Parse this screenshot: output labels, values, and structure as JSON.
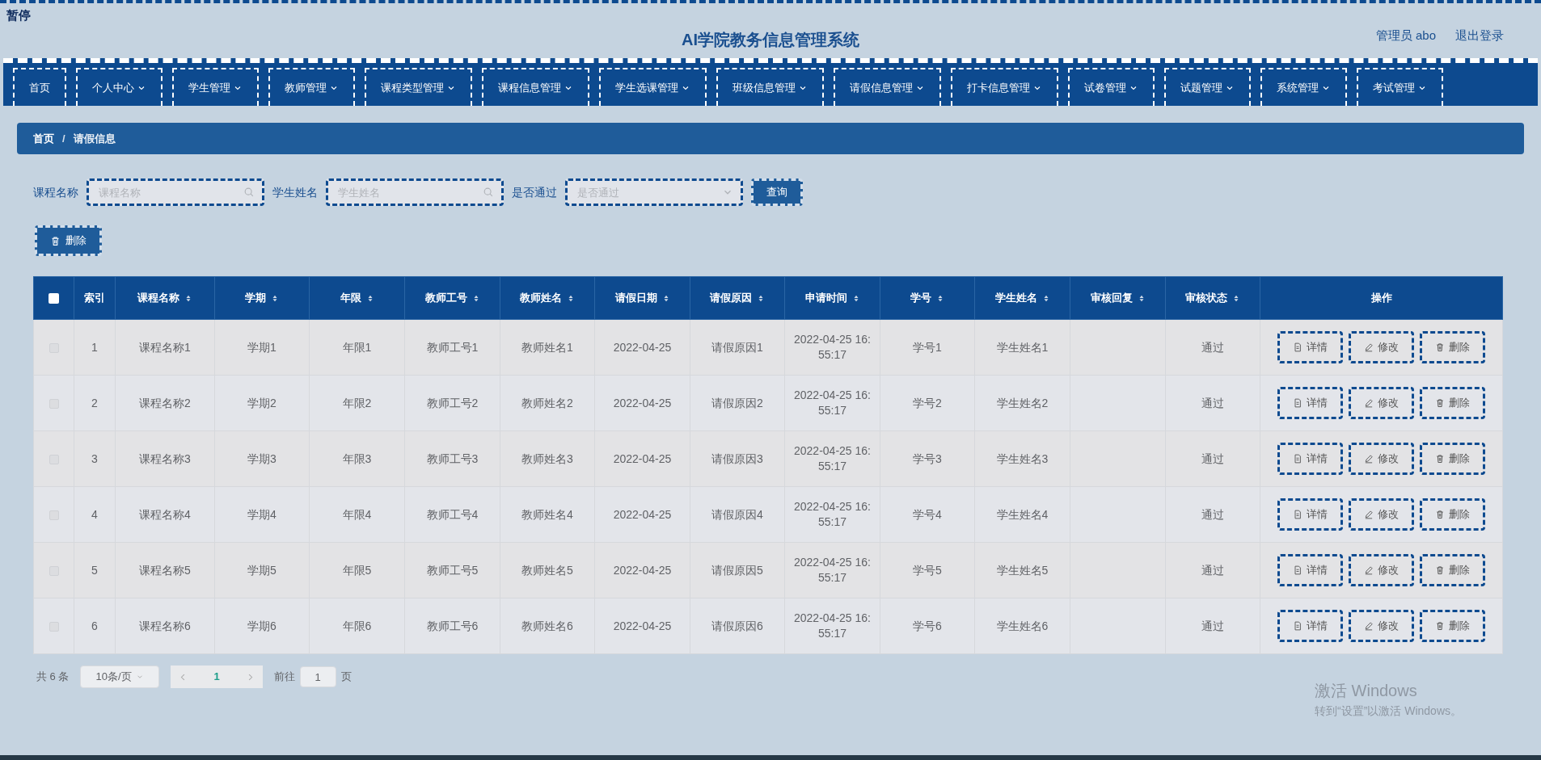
{
  "pause_label": "暂停",
  "header": {
    "title": "AI学院教务信息管理系统",
    "user": "管理员 abo",
    "logout": "退出登录"
  },
  "nav": [
    {
      "label": "首页",
      "dropdown": false
    },
    {
      "label": "个人中心",
      "dropdown": true
    },
    {
      "label": "学生管理",
      "dropdown": true
    },
    {
      "label": "教师管理",
      "dropdown": true
    },
    {
      "label": "课程类型管理",
      "dropdown": true
    },
    {
      "label": "课程信息管理",
      "dropdown": true
    },
    {
      "label": "学生选课管理",
      "dropdown": true
    },
    {
      "label": "班级信息管理",
      "dropdown": true
    },
    {
      "label": "请假信息管理",
      "dropdown": true
    },
    {
      "label": "打卡信息管理",
      "dropdown": true
    },
    {
      "label": "试卷管理",
      "dropdown": true
    },
    {
      "label": "试题管理",
      "dropdown": true
    },
    {
      "label": "系统管理",
      "dropdown": true
    },
    {
      "label": "考试管理",
      "dropdown": true
    }
  ],
  "breadcrumb": {
    "items": [
      "首页",
      "请假信息"
    ],
    "separator": "/"
  },
  "filters": [
    {
      "label": "课程名称",
      "placeholder": "课程名称",
      "kind": "search"
    },
    {
      "label": "学生姓名",
      "placeholder": "学生姓名",
      "kind": "search"
    },
    {
      "label": "是否通过",
      "placeholder": "是否通过",
      "kind": "select"
    }
  ],
  "search_button": "查询",
  "delete_button": "删除",
  "table": {
    "select_all_checked": false,
    "columns": [
      {
        "label": "索引",
        "sortable": false
      },
      {
        "label": "课程名称",
        "sortable": true
      },
      {
        "label": "学期",
        "sortable": true
      },
      {
        "label": "年限",
        "sortable": true
      },
      {
        "label": "教师工号",
        "sortable": true
      },
      {
        "label": "教师姓名",
        "sortable": true
      },
      {
        "label": "请假日期",
        "sortable": true
      },
      {
        "label": "请假原因",
        "sortable": true
      },
      {
        "label": "申请时间",
        "sortable": true
      },
      {
        "label": "学号",
        "sortable": true
      },
      {
        "label": "学生姓名",
        "sortable": true
      },
      {
        "label": "审核回复",
        "sortable": true
      },
      {
        "label": "审核状态",
        "sortable": true
      },
      {
        "label": "操作",
        "sortable": false
      }
    ],
    "rows": [
      {
        "checked": false,
        "cells": [
          "1",
          "课程名称1",
          "学期1",
          "年限1",
          "教师工号1",
          "教师姓名1",
          "2022-04-25",
          "请假原因1",
          "2022-04-25 16:55:17",
          "学号1",
          "学生姓名1",
          null,
          "通过"
        ],
        "actions": [
          "详情",
          "修改",
          "删除"
        ]
      },
      {
        "checked": false,
        "cells": [
          "2",
          "课程名称2",
          "学期2",
          "年限2",
          "教师工号2",
          "教师姓名2",
          "2022-04-25",
          "请假原因2",
          "2022-04-25 16:55:17",
          "学号2",
          "学生姓名2",
          null,
          "通过"
        ],
        "actions": [
          "详情",
          "修改",
          "删除"
        ]
      },
      {
        "checked": false,
        "cells": [
          "3",
          "课程名称3",
          "学期3",
          "年限3",
          "教师工号3",
          "教师姓名3",
          "2022-04-25",
          "请假原因3",
          "2022-04-25 16:55:17",
          "学号3",
          "学生姓名3",
          null,
          "通过"
        ],
        "actions": [
          "详情",
          "修改",
          "删除"
        ]
      },
      {
        "checked": false,
        "cells": [
          "4",
          "课程名称4",
          "学期4",
          "年限4",
          "教师工号4",
          "教师姓名4",
          "2022-04-25",
          "请假原因4",
          "2022-04-25 16:55:17",
          "学号4",
          "学生姓名4",
          null,
          "通过"
        ],
        "actions": [
          "详情",
          "修改",
          "删除"
        ]
      },
      {
        "checked": false,
        "cells": [
          "5",
          "课程名称5",
          "学期5",
          "年限5",
          "教师工号5",
          "教师姓名5",
          "2022-04-25",
          "请假原因5",
          "2022-04-25 16:55:17",
          "学号5",
          "学生姓名5",
          null,
          "通过"
        ],
        "actions": [
          "详情",
          "修改",
          "删除"
        ]
      },
      {
        "checked": false,
        "cells": [
          "6",
          "课程名称6",
          "学期6",
          "年限6",
          "教师工号6",
          "教师姓名6",
          "2022-04-25",
          "请假原因6",
          "2022-04-25 16:55:17",
          "学号6",
          "学生姓名6",
          null,
          "通过"
        ],
        "actions": [
          "详情",
          "修改",
          "删除"
        ]
      }
    ]
  },
  "pagination": {
    "total": "共 6 条",
    "page_size": "10条/页",
    "pages": [
      {
        "label": "1",
        "selected": true
      }
    ],
    "goto_label": "前往",
    "goto_value": "1",
    "goto_suffix": "页"
  },
  "os_notice": {
    "title": "激活 Windows",
    "subtitle": "转到“设置”以激活 Windows。"
  }
}
